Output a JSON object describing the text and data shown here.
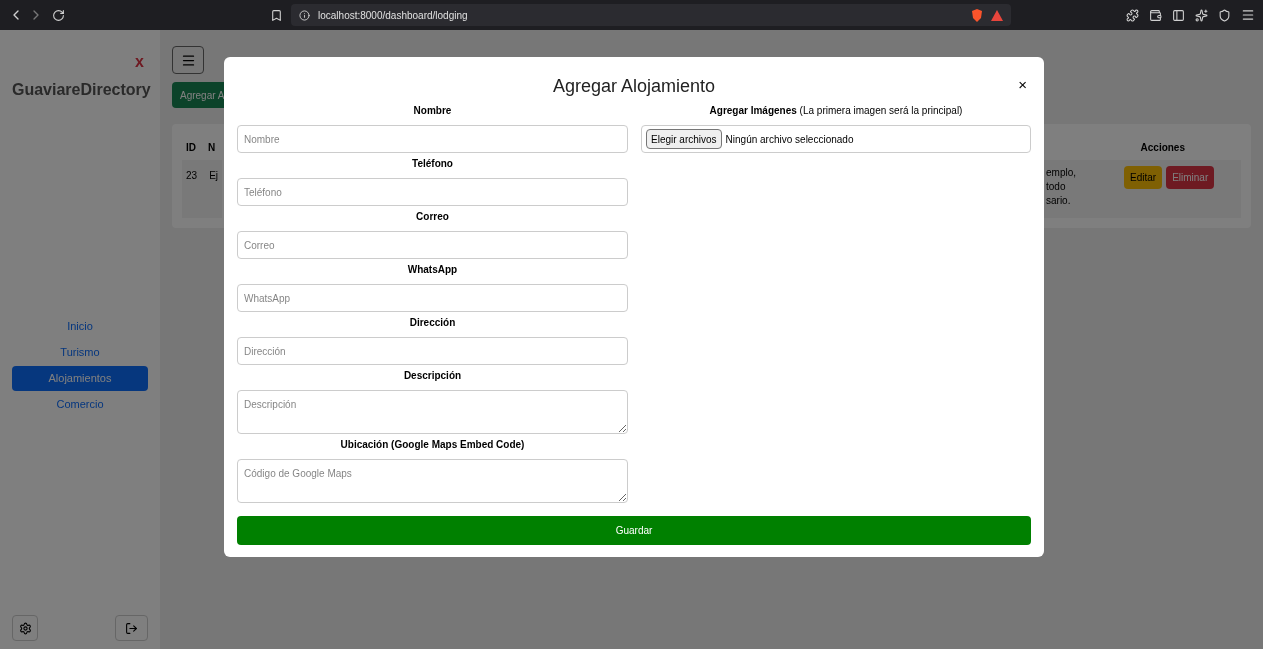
{
  "browser": {
    "url": "localhost:8000/dashboard/lodging"
  },
  "sidebar": {
    "close_mark": "x",
    "brand": "GuaviareDirectory",
    "items": [
      {
        "label": "Inicio",
        "selected": false
      },
      {
        "label": "Turismo",
        "selected": false
      },
      {
        "label": "Alojamientos",
        "selected": true
      },
      {
        "label": "Comercio",
        "selected": false
      }
    ]
  },
  "header": {
    "add_button": "Agregar A"
  },
  "table": {
    "columns": [
      "ID",
      "N"
    ],
    "actions_column": "Acciones",
    "rows": [
      {
        "cells": [
          "23",
          "Ej"
        ],
        "description_lines": [
          "emplo,",
          "todo",
          "sario."
        ],
        "actions": [
          {
            "label": "Editar",
            "kind": "edit"
          },
          {
            "label": "Eliminar",
            "kind": "delete"
          }
        ]
      }
    ]
  },
  "modal": {
    "title": "Agregar Alojamiento",
    "close": "×",
    "fields": [
      {
        "label": "Nombre",
        "placeholder": "Nombre",
        "kind": "input"
      },
      {
        "label": "Teléfono",
        "placeholder": "Teléfono",
        "kind": "input"
      },
      {
        "label": "Correo",
        "placeholder": "Correo",
        "kind": "input"
      },
      {
        "label": "WhatsApp",
        "placeholder": "WhatsApp",
        "kind": "input"
      },
      {
        "label": "Dirección",
        "placeholder": "Dirección",
        "kind": "input"
      },
      {
        "label": "Descripción",
        "placeholder": "Descripción",
        "kind": "textarea"
      },
      {
        "label": "Ubicación (Google Maps Embed Code)",
        "placeholder": "Código de Google Maps",
        "kind": "textarea"
      }
    ],
    "images": {
      "label": "**Agregar Imágenes** (La primera imagen será la principal)",
      "button": "Elegir archivos",
      "status": "Ningún archivo seleccionado"
    },
    "submit": "Guardar"
  }
}
